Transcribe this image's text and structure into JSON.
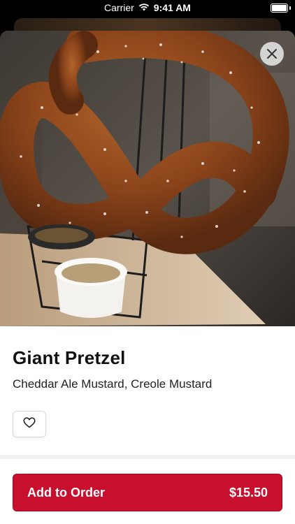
{
  "status_bar": {
    "carrier": "Carrier",
    "time": "9:41 AM",
    "wifi_icon": "wifi-icon",
    "battery_icon": "battery-icon",
    "battery_level": 1.0
  },
  "item": {
    "image_alt": "pretzel-photo",
    "title": "Giant Pretzel",
    "description": "Cheddar Ale Mustard, Creole Mustard",
    "favorite_icon": "heart-icon",
    "close_icon": "close-icon"
  },
  "order_button": {
    "label": "Add to Order",
    "price": "$15.50"
  },
  "colors": {
    "accent": "#c8102e",
    "title_text": "#111111"
  }
}
